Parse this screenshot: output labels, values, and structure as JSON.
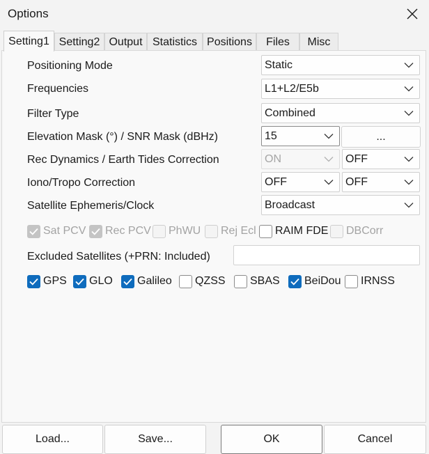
{
  "window": {
    "title": "Options"
  },
  "tabs": [
    {
      "label": "Setting1"
    },
    {
      "label": "Setting2"
    },
    {
      "label": "Output"
    },
    {
      "label": "Statistics"
    },
    {
      "label": "Positions"
    },
    {
      "label": "Files"
    },
    {
      "label": "Misc"
    }
  ],
  "settings": {
    "positioning_mode": {
      "label": "Positioning Mode",
      "value": "Static"
    },
    "frequencies": {
      "label": "Frequencies",
      "value": "L1+L2/E5b"
    },
    "filter_type": {
      "label": "Filter Type",
      "value": "Combined"
    },
    "elevation_mask": {
      "label": "Elevation Mask (°) / SNR Mask (dBHz)",
      "value": "15",
      "button": "..."
    },
    "rec_dynamics": {
      "label": "Rec Dynamics / Earth Tides Correction",
      "dynamics_value": "ON",
      "tides_value": "OFF"
    },
    "iono_tropo": {
      "label": "Iono/Tropo Correction",
      "iono_value": "OFF",
      "tropo_value": "OFF"
    },
    "ephemeris": {
      "label": "Satellite Ephemeris/Clock",
      "value": "Broadcast"
    },
    "options_checkboxes": [
      {
        "label": "Sat PCV",
        "checked": true,
        "disabled": true
      },
      {
        "label": "Rec PCV",
        "checked": true,
        "disabled": true
      },
      {
        "label": "PhWU",
        "checked": false,
        "disabled": true
      },
      {
        "label": "Rej Ecl",
        "checked": false,
        "disabled": true
      },
      {
        "label": "RAIM FDE",
        "checked": false,
        "disabled": false
      },
      {
        "label": "DBCorr",
        "checked": false,
        "disabled": true
      }
    ],
    "excluded_satellites": {
      "label": "Excluded Satellites (+PRN: Included)",
      "value": ""
    },
    "constellations": [
      {
        "label": "GPS",
        "checked": true
      },
      {
        "label": "GLO",
        "checked": true
      },
      {
        "label": "Galileo",
        "checked": true
      },
      {
        "label": "QZSS",
        "checked": false
      },
      {
        "label": "SBAS",
        "checked": false
      },
      {
        "label": "BeiDou",
        "checked": true
      },
      {
        "label": "IRNSS",
        "checked": false
      }
    ]
  },
  "footer": {
    "load": "Load...",
    "save": "Save...",
    "ok": "OK",
    "cancel": "Cancel"
  },
  "colors": {
    "accent": "#0f6cbd",
    "background": "#f3f3f3",
    "panel": "#f9f9f9"
  }
}
